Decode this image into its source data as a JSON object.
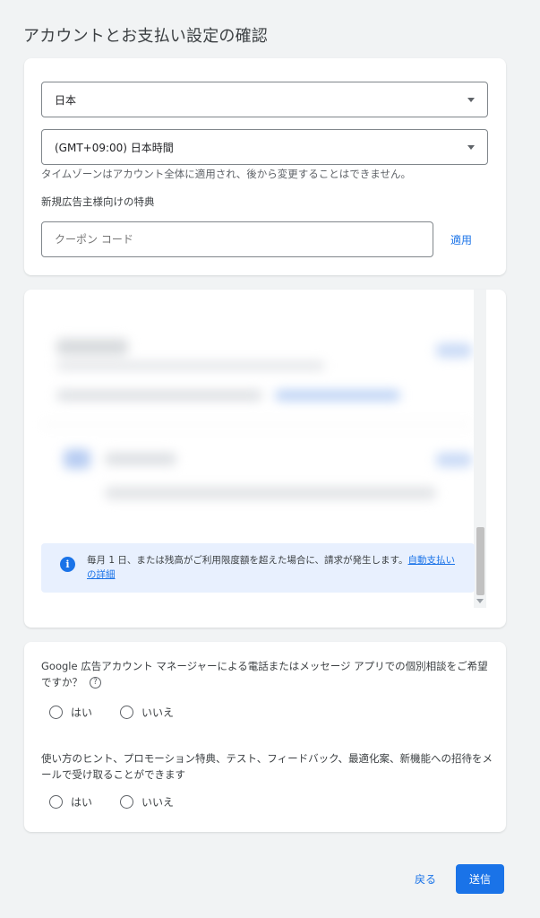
{
  "page": {
    "title": "アカウントとお支払い設定の確認"
  },
  "settings": {
    "country": "日本",
    "timezone": "(GMT+09:00) 日本時間",
    "timezone_helper": "タイムゾーンはアカウント全体に適用され、後から変更することはできません。",
    "promo_label": "新規広告主様向けの特典",
    "coupon_placeholder": "クーポン コード",
    "apply_label": "適用"
  },
  "billing_info": {
    "text": "毎月 1 日、または残高がご利用限度額を超えた場合に、請求が発生します。",
    "link": "自動支払いの詳細"
  },
  "questions": [
    {
      "text": "Google 広告アカウント マネージャーによる電話またはメッセージ アプリでの個別相談をご希望ですか？",
      "yes": "はい",
      "no": "いいえ"
    },
    {
      "text": "使い方のヒント、プロモーション特典、テスト、フィードバック、最適化案、新機能への招待をメールで受け取ることができます",
      "yes": "はい",
      "no": "いいえ"
    }
  ],
  "footer": {
    "back_label": "戻る",
    "submit_label": "送信"
  },
  "colors": {
    "accent": "#1a73e8",
    "info_background": "#e8f0fe",
    "page_background": "#f1f3f4"
  },
  "icons": [
    "caret-down-icon",
    "info-icon",
    "help-icon"
  ]
}
